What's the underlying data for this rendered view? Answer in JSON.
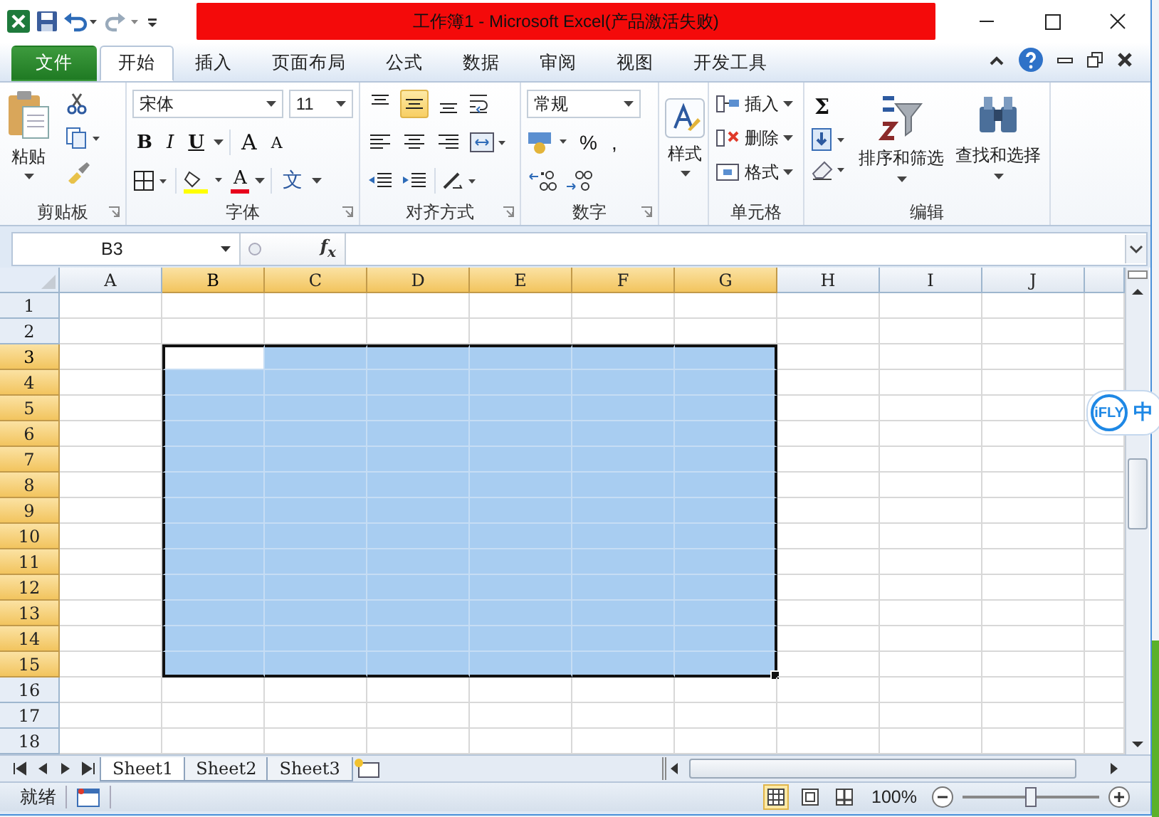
{
  "window": {
    "title": "工作簿1  -  Microsoft Excel(产品激活失败)"
  },
  "ribbon_tabs": [
    {
      "label": "文件",
      "kind": "file",
      "selected": false
    },
    {
      "label": "开始",
      "kind": "tab",
      "selected": true
    },
    {
      "label": "插入",
      "kind": "tab",
      "selected": false
    },
    {
      "label": "页面布局",
      "kind": "tab",
      "selected": false
    },
    {
      "label": "公式",
      "kind": "tab",
      "selected": false
    },
    {
      "label": "数据",
      "kind": "tab",
      "selected": false
    },
    {
      "label": "审阅",
      "kind": "tab",
      "selected": false
    },
    {
      "label": "视图",
      "kind": "tab",
      "selected": false
    },
    {
      "label": "开发工具",
      "kind": "tab",
      "selected": false
    }
  ],
  "clipboard": {
    "label": "剪贴板",
    "paste": "粘贴"
  },
  "font": {
    "label": "字体",
    "name": "宋体",
    "size": "11",
    "bold": "B",
    "italic": "I",
    "underline": "U",
    "grow": "A",
    "shrink": "A",
    "color_glyph": "A",
    "phonetic": "文"
  },
  "alignment": {
    "label": "对齐方式",
    "vertical": [
      {
        "kind": "top",
        "selected": false
      },
      {
        "kind": "middle",
        "selected": true
      },
      {
        "kind": "bottom",
        "selected": false
      }
    ]
  },
  "number": {
    "label": "数字",
    "format": "常规",
    "percent": "%",
    "comma": ","
  },
  "styles": {
    "button": "样式"
  },
  "cells": {
    "label": "单元格",
    "buttons": [
      {
        "kind": "insert",
        "label": "插入"
      },
      {
        "kind": "delete",
        "label": "删除"
      },
      {
        "kind": "format",
        "label": "格式"
      }
    ]
  },
  "editing": {
    "label": "编辑",
    "sum": "Σ",
    "sort": "排序和筛选",
    "find": "查找和选择"
  },
  "formula_bar": {
    "name_box": "B3",
    "fx": "f$_{x}$"
  },
  "columns": [
    {
      "label": "A",
      "selected": false,
      "active": false
    },
    {
      "label": "B",
      "selected": true,
      "active": true
    },
    {
      "label": "C",
      "selected": true,
      "active": false
    },
    {
      "label": "D",
      "selected": true,
      "active": false
    },
    {
      "label": "E",
      "selected": true,
      "active": false
    },
    {
      "label": "F",
      "selected": true,
      "active": false
    },
    {
      "label": "G",
      "selected": true,
      "active": false
    },
    {
      "label": "H",
      "selected": false,
      "active": false
    },
    {
      "label": "I",
      "selected": false,
      "active": false
    },
    {
      "label": "J",
      "selected": false,
      "active": false
    }
  ],
  "rows": [
    {
      "label": "1",
      "selected": false,
      "active": false
    },
    {
      "label": "2",
      "selected": false,
      "active": false
    },
    {
      "label": "3",
      "selected": true,
      "active": true
    },
    {
      "label": "4",
      "selected": true,
      "active": false
    },
    {
      "label": "5",
      "selected": true,
      "active": false
    },
    {
      "label": "6",
      "selected": true,
      "active": false
    },
    {
      "label": "7",
      "selected": true,
      "active": false
    },
    {
      "label": "8",
      "selected": true,
      "active": false
    },
    {
      "label": "9",
      "selected": true,
      "active": false
    },
    {
      "label": "10",
      "selected": true,
      "active": false
    },
    {
      "label": "11",
      "selected": true,
      "active": false
    },
    {
      "label": "12",
      "selected": true,
      "active": false
    },
    {
      "label": "13",
      "selected": true,
      "active": false
    },
    {
      "label": "14",
      "selected": true,
      "active": false
    },
    {
      "label": "15",
      "selected": true,
      "active": false
    },
    {
      "label": "16",
      "selected": false,
      "active": false
    },
    {
      "label": "17",
      "selected": false,
      "active": false
    },
    {
      "label": "18",
      "selected": false,
      "active": false
    }
  ],
  "sheets": [
    {
      "label": "Sheet1",
      "selected": true
    },
    {
      "label": "Sheet2",
      "selected": false
    },
    {
      "label": "Sheet3",
      "selected": false
    }
  ],
  "status": {
    "text": "就绪",
    "views": [
      {
        "kind": "normal",
        "selected": true
      },
      {
        "kind": "layout",
        "selected": false
      },
      {
        "kind": "pagebreak",
        "selected": false
      }
    ],
    "zoom": "100%",
    "zoom_slider": {
      "level": 0.5
    }
  },
  "ime": {
    "logo": "iFLY",
    "mode": "中"
  }
}
